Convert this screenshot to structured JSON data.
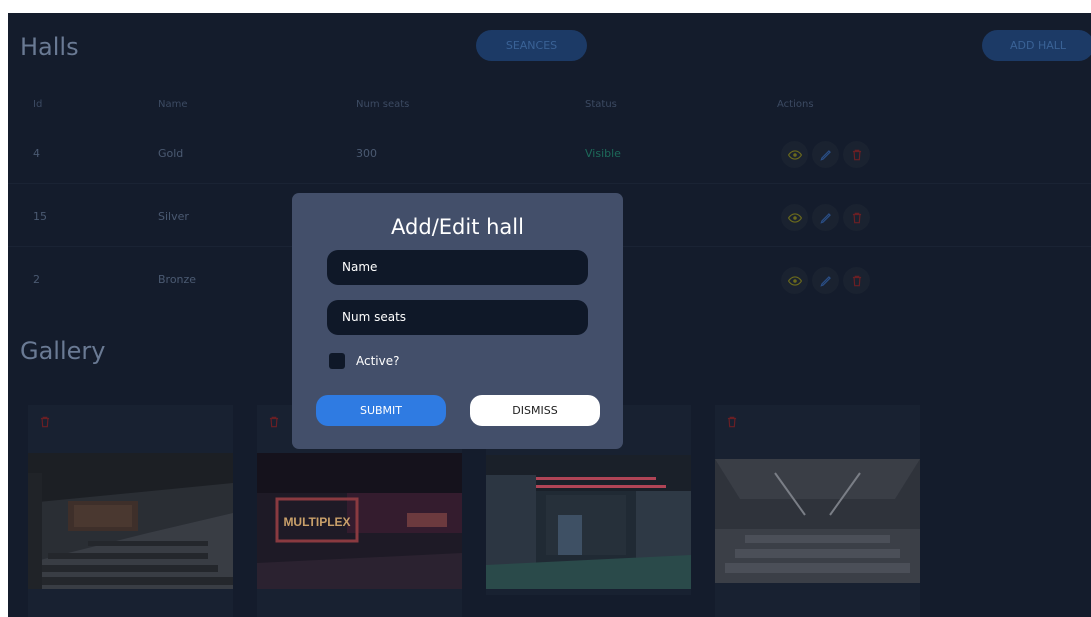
{
  "halls": {
    "title": "Halls",
    "seances_label": "SEANCES",
    "add_hall_label": "ADD HALL",
    "columns": [
      "Id",
      "Name",
      "Num seats",
      "Status",
      "Actions"
    ],
    "rows": [
      {
        "id": "4",
        "name": "Gold",
        "seats": "300",
        "status": "Visible"
      },
      {
        "id": "15",
        "name": "Silver",
        "seats": "",
        "status": ""
      },
      {
        "id": "2",
        "name": "Bronze",
        "seats": "",
        "status": ""
      }
    ],
    "action_icons": [
      "eye-icon",
      "pencil-icon",
      "trash-icon"
    ]
  },
  "gallery": {
    "title": "Gallery",
    "images": [
      {
        "name": "cinema-hall-dark-image"
      },
      {
        "name": "multiplex-lobby-image",
        "sign": "MULTIPLEX"
      },
      {
        "name": "neon-hall-image"
      },
      {
        "name": "grey-auditorium-image"
      }
    ]
  },
  "modal": {
    "title": "Add/Edit hall",
    "name_placeholder": "Name",
    "seats_placeholder": "Num seats",
    "active_label": "Active?",
    "submit_label": "SUBMIT",
    "dismiss_label": "DISMISS"
  },
  "colors": {
    "background": "#141c2c",
    "modal": "#434f6a",
    "submit": "#2f7be2",
    "eye": "#6b6a1c",
    "pencil": "#2a4e86",
    "trash": "#6a1f24",
    "status_visible": "#1d6a5a"
  }
}
